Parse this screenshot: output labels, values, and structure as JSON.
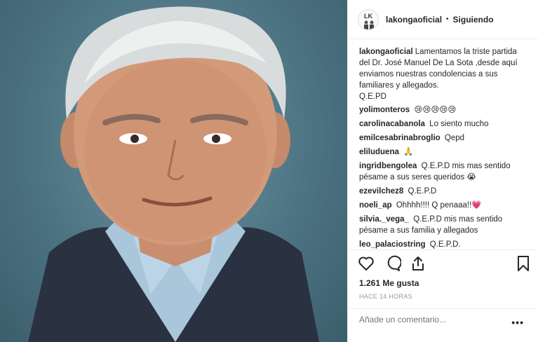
{
  "post": {
    "username": "lakongaoficial",
    "follow_status": "Siguiendo",
    "separator": "•",
    "avatar_text": "LK"
  },
  "caption": {
    "user": "lakongaoficial",
    "text": "Lamentamos la triste partida del Dr. José Manuel De La Sota ,desde aquí enviamos nuestras condolencias a sus familiares y allegados.",
    "text2": "Q.E.PD"
  },
  "comments": [
    {
      "user": "yolimonteros",
      "text": "😢😢😢😢😢"
    },
    {
      "user": "carolinacabanola",
      "text": "Lo siento mucho"
    },
    {
      "user": "emilcesabrinabroglio",
      "text": "Qepd"
    },
    {
      "user": "eliluduena",
      "text": "🙏"
    },
    {
      "user": "ingridbengolea",
      "text": "Q.E.P.D mis mas sentido pésame a sus seres queridos 😭"
    },
    {
      "user": "ezevilchez8",
      "text": "Q.E.P.D"
    },
    {
      "user": "noeli_ap",
      "text": "Ohhhh!!!! Q penaaa!!💗"
    },
    {
      "user": "silvia._vega_",
      "text": "Q.E.P.D mis mas sentido pésame a sus familia y allegados"
    },
    {
      "user": "leo_palaciostring",
      "text": "Q.E.P.D."
    }
  ],
  "actions": {
    "like_icon": "heart-icon",
    "comment_icon": "comment-icon",
    "share_icon": "share-icon",
    "save_icon": "bookmark-icon"
  },
  "likes": "1.261 Me gusta",
  "timestamp": "HACE 14 HORAS",
  "add_comment": {
    "placeholder": "Añade un comentario..."
  },
  "more_label": "•••"
}
